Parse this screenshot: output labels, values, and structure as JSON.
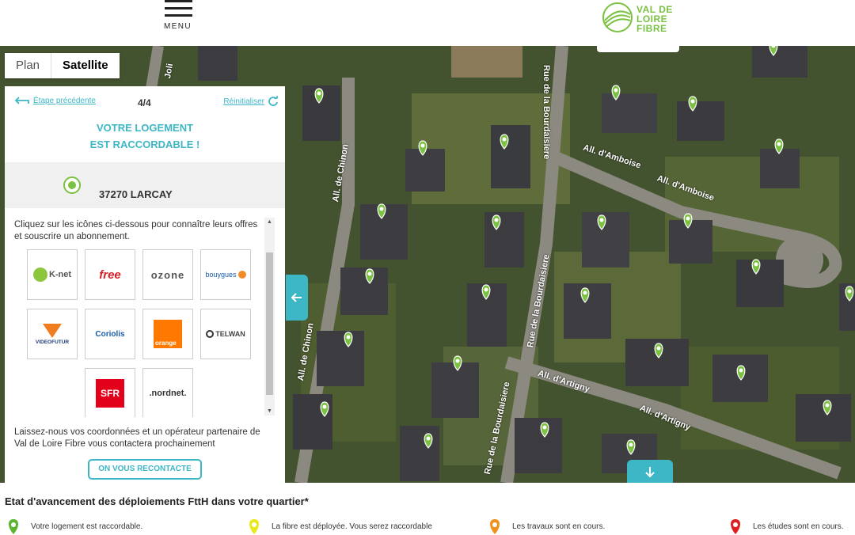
{
  "header": {
    "menu_label": "MENU",
    "logo_lines": [
      "VAL DE",
      "LOIRE",
      "FIBRE"
    ]
  },
  "map_type": {
    "plan_label": "Plan",
    "satellite_label": "Satellite",
    "selected": "Satellite"
  },
  "map": {
    "street_labels": [
      "Rue de la Bourdaisiere",
      "All. d'Amboise",
      "All. d'Amboise",
      "All. de Chinon",
      "All. de Chinon",
      "Rue de la Bourdaisiere",
      "Rue de la Bourdaisiere",
      "All. d'Artigny",
      "All. d'Artigny",
      "Joli"
    ],
    "marker_color": "#7bc142"
  },
  "panel": {
    "back_label": "Étape précédente",
    "step": "4/4",
    "reset_label": "Réinitialiser",
    "heading_line1": "VOTRE LOGEMENT",
    "heading_line2": "EST RACCORDABLE !",
    "address": "37270 LARCAY",
    "intro_text": "Cliquez sur les icônes ci-dessous pour connaître leurs offres et souscrire un abonnement.",
    "operators": [
      {
        "name": "K-net",
        "label": "K-net",
        "icon": "knet-logo"
      },
      {
        "name": "Free",
        "label": "free",
        "icon": "free-logo"
      },
      {
        "name": "Ozone",
        "label": "ozone",
        "icon": "ozone-logo"
      },
      {
        "name": "Bouygues",
        "label": "bouygues",
        "icon": "bouygues-logo"
      },
      {
        "name": "Videofutur",
        "label": "VIDEOFUTUR",
        "icon": "videofutur-logo"
      },
      {
        "name": "Coriolis",
        "label": "Coriolis",
        "icon": "coriolis-logo"
      },
      {
        "name": "Orange",
        "label": "orange",
        "icon": "orange-logo"
      },
      {
        "name": "Telwan",
        "label": "TELWAN",
        "icon": "telwan-logo"
      },
      {
        "name": "SFR",
        "label": "SFR",
        "icon": "sfr-logo"
      },
      {
        "name": "Nordnet",
        "label": ".nordnet.",
        "icon": "nordnet-logo"
      }
    ],
    "contact_text": "Laissez-nous vos coordonnées et un opérateur partenaire de Val de Loire Fibre vous contactera prochainement",
    "cta_label": "ON VOUS RECONTACTE"
  },
  "footer": {
    "title": "Etat d'avancement des déploiements FttH dans votre quartier*",
    "legend": [
      {
        "label": "Votre logement est raccordable.",
        "color": "#5cb531"
      },
      {
        "label": "La fibre est déployée. Vous serez raccordable",
        "color": "#e8e81a"
      },
      {
        "label": "Les travaux sont en cours.",
        "color": "#f0901e"
      },
      {
        "label": "Les études sont en cours.",
        "color": "#e02020"
      }
    ]
  },
  "colors": {
    "accent": "#3db6c6",
    "brand_green": "#7bc142"
  }
}
